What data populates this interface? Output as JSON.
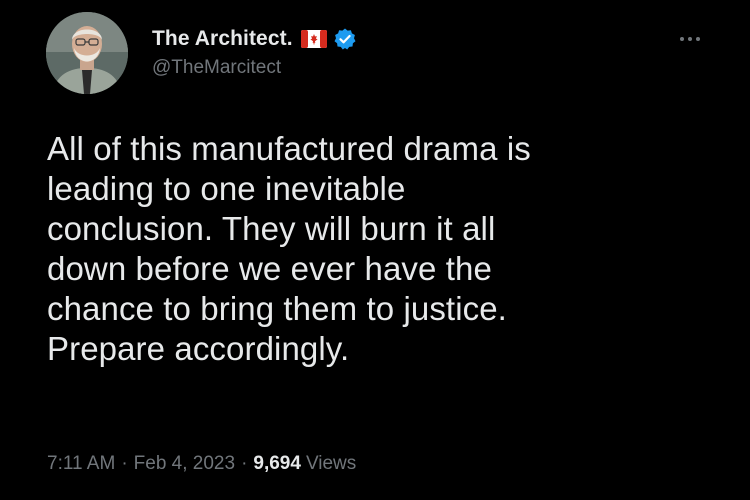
{
  "author": {
    "display_name": "The Architect.",
    "handle": "@TheMarcitect",
    "flag_icon": "canada-flag-icon",
    "verified_icon": "verified-badge-icon",
    "verified_color": "#1d9bf0"
  },
  "tweet": {
    "text": "All of this manufactured drama is\nleading to one inevitable\nconclusion. They will burn it all\ndown before we ever have the\nchance to bring them to justice.\nPrepare accordingly."
  },
  "meta": {
    "time": "7:11 AM",
    "separator_1": "·",
    "date": "Feb 4, 2023",
    "separator_2": "·",
    "views_count": "9,694",
    "views_label": "Views"
  },
  "icons": {
    "more": "more-options-icon"
  },
  "colors": {
    "background": "#000000",
    "primary_text": "#e7e9ea",
    "secondary_text": "#71767b"
  }
}
